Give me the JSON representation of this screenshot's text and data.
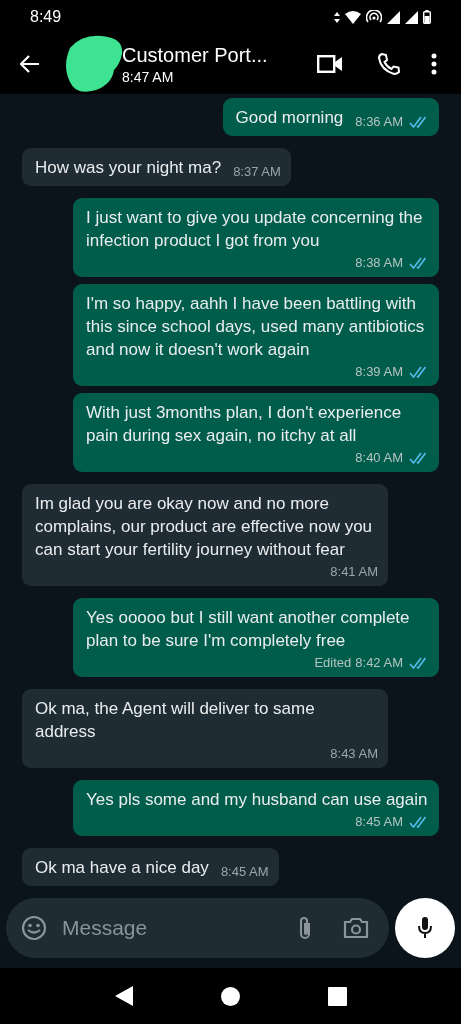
{
  "status_bar": {
    "time": "8:49"
  },
  "header": {
    "title": "Customer Port...",
    "subtitle": "8:47 AM"
  },
  "messages": [
    {
      "kind": "out",
      "text": "Good morning",
      "time": "8:36 AM",
      "read": true
    },
    {
      "kind": "in",
      "text": "How was your night ma?",
      "time": "8:37 AM"
    },
    {
      "kind": "out",
      "text": "I just want to give you update concerning the infection product I got from you",
      "time": "8:38 AM",
      "read": true
    },
    {
      "kind": "out",
      "text": "I'm so happy, aahh I have been battling with this since school days, used many antibiotics and now it doesn't work again",
      "time": "8:39 AM",
      "read": true
    },
    {
      "kind": "out",
      "text": "With just 3months plan, I don't experience pain during sex again, no itchy at all",
      "time": "8:40 AM",
      "read": true
    },
    {
      "kind": "in",
      "text": "Im glad you are okay now and no more complains, our product are effective now you can start your fertility journey without fear",
      "time": "8:41 AM"
    },
    {
      "kind": "out",
      "text": "Yes ooooo but I still want another complete plan to be sure I'm completely free",
      "edited": "Edited",
      "time": "8:42 AM",
      "read": true
    },
    {
      "kind": "in",
      "text": "Ok ma, the Agent will deliver to same address",
      "time": "8:43 AM"
    },
    {
      "kind": "out",
      "text": "Yes pls some and my husband can use again",
      "time": "8:45 AM",
      "read": true
    },
    {
      "kind": "in",
      "text": "Ok ma have a nice day",
      "time": "8:45 AM"
    }
  ],
  "composer": {
    "placeholder": "Message"
  }
}
